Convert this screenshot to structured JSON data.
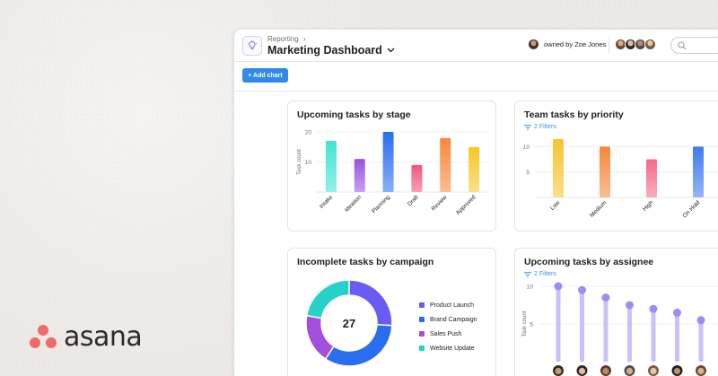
{
  "brand": {
    "name": "asana",
    "color": "#f06a6a"
  },
  "header": {
    "breadcrumb": "Reporting",
    "breadcrumb_separator": "›",
    "title": "Marketing Dashboard",
    "owner_text": "owned by Zoe Jones",
    "icons": [
      "lightbulb-icon",
      "chevron-down-icon",
      "search-icon"
    ]
  },
  "toolbar": {
    "add_chart_label": "+ Add chart",
    "accent": "#2f8ae8"
  },
  "cards": {
    "stage": {
      "title": "Upcoming tasks by stage"
    },
    "priority": {
      "title": "Team tasks by priority",
      "filters_label": "2 Filters"
    },
    "campaign": {
      "title": "Incomplete tasks by campaign",
      "center_value": "27"
    },
    "assignee": {
      "title": "Upcoming tasks by assignee",
      "filters_label": "2 Filters"
    }
  },
  "chart_data": [
    {
      "type": "bar",
      "title": "Upcoming tasks by stage",
      "ylabel": "Task count",
      "ylim": [
        0,
        20
      ],
      "yticks": [
        10,
        20
      ],
      "grid": true,
      "categories": [
        "Intake",
        "Ideation",
        "Planning",
        "Draft",
        "Review",
        "Approved"
      ],
      "values": [
        17,
        11,
        20,
        9,
        18,
        15
      ],
      "colors": [
        "#3ee4d4",
        "#9b52e0",
        "#2b6df0",
        "#f0567a",
        "#f6883a",
        "#f5c824"
      ]
    },
    {
      "type": "bar",
      "title": "Team tasks by priority",
      "ylim": [
        0,
        12
      ],
      "yticks": [
        5,
        10
      ],
      "grid": true,
      "categories": [
        "Low",
        "Medium",
        "High",
        "On Hold"
      ],
      "values": [
        11.5,
        10,
        7.5,
        10
      ],
      "colors": [
        "#f7c430",
        "#f6883a",
        "#f56a88",
        "#3f7af0"
      ]
    },
    {
      "type": "pie",
      "title": "Incomplete tasks by campaign",
      "total_label": "27",
      "labels": [
        "Product Launch",
        "Brand Campaign",
        "Sales Push",
        "Website Update"
      ],
      "values": [
        7,
        9,
        5,
        6
      ],
      "colors": [
        "#6a5cf2",
        "#2b6df0",
        "#a24fe0",
        "#27d0c8"
      ]
    },
    {
      "type": "scatter",
      "title": "Upcoming tasks by assignee",
      "ylabel": "Task count",
      "ylim": [
        0,
        10
      ],
      "yticks": [
        5,
        10
      ],
      "grid": true,
      "values": [
        10,
        9.5,
        8.5,
        7.5,
        7,
        6.5,
        5.5
      ],
      "colors": [
        "#9b8ef5"
      ]
    }
  ]
}
